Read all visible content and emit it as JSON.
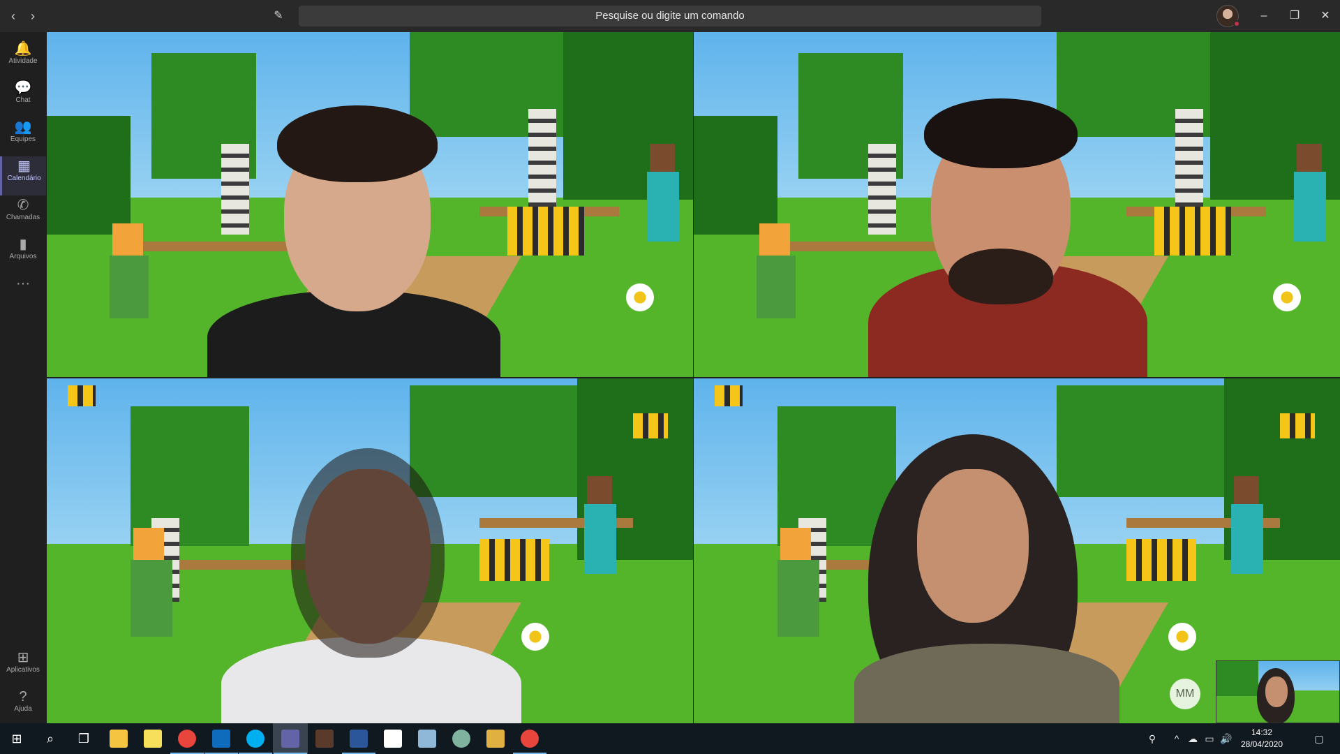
{
  "titlebar": {
    "search_placeholder": "Pesquise ou digite um comando",
    "back_icon": "‹",
    "forward_icon": "›",
    "compose_icon": "✎",
    "minimize": "–",
    "restore": "❐",
    "close": "✕"
  },
  "rail": {
    "items": [
      {
        "label": "Atividade",
        "icon": "🔔"
      },
      {
        "label": "Chat",
        "icon": "💬"
      },
      {
        "label": "Equipes",
        "icon": "👥"
      },
      {
        "label": "Calendário",
        "icon": "▦"
      },
      {
        "label": "Chamadas",
        "icon": "✆"
      },
      {
        "label": "Arquivos",
        "icon": "▮"
      },
      {
        "label": "",
        "icon": "···"
      }
    ],
    "bottom": [
      {
        "label": "Aplicativos",
        "icon": "⊞"
      },
      {
        "label": "Ajuda",
        "icon": "?"
      }
    ]
  },
  "call": {
    "avatar_initials": "MM"
  },
  "taskbar": {
    "start_icon": "⊞",
    "search_icon": "⌕",
    "taskview_icon": "❐",
    "tray_icons": [
      "⚲",
      "^",
      "☁",
      "▭",
      "🔊",
      "▮"
    ],
    "time": "14:32",
    "date": "28/04/2020",
    "notifications_icon": "▢"
  },
  "colors": {
    "teams_accent": "#6264a7",
    "presence_busy": "#c4314b"
  }
}
